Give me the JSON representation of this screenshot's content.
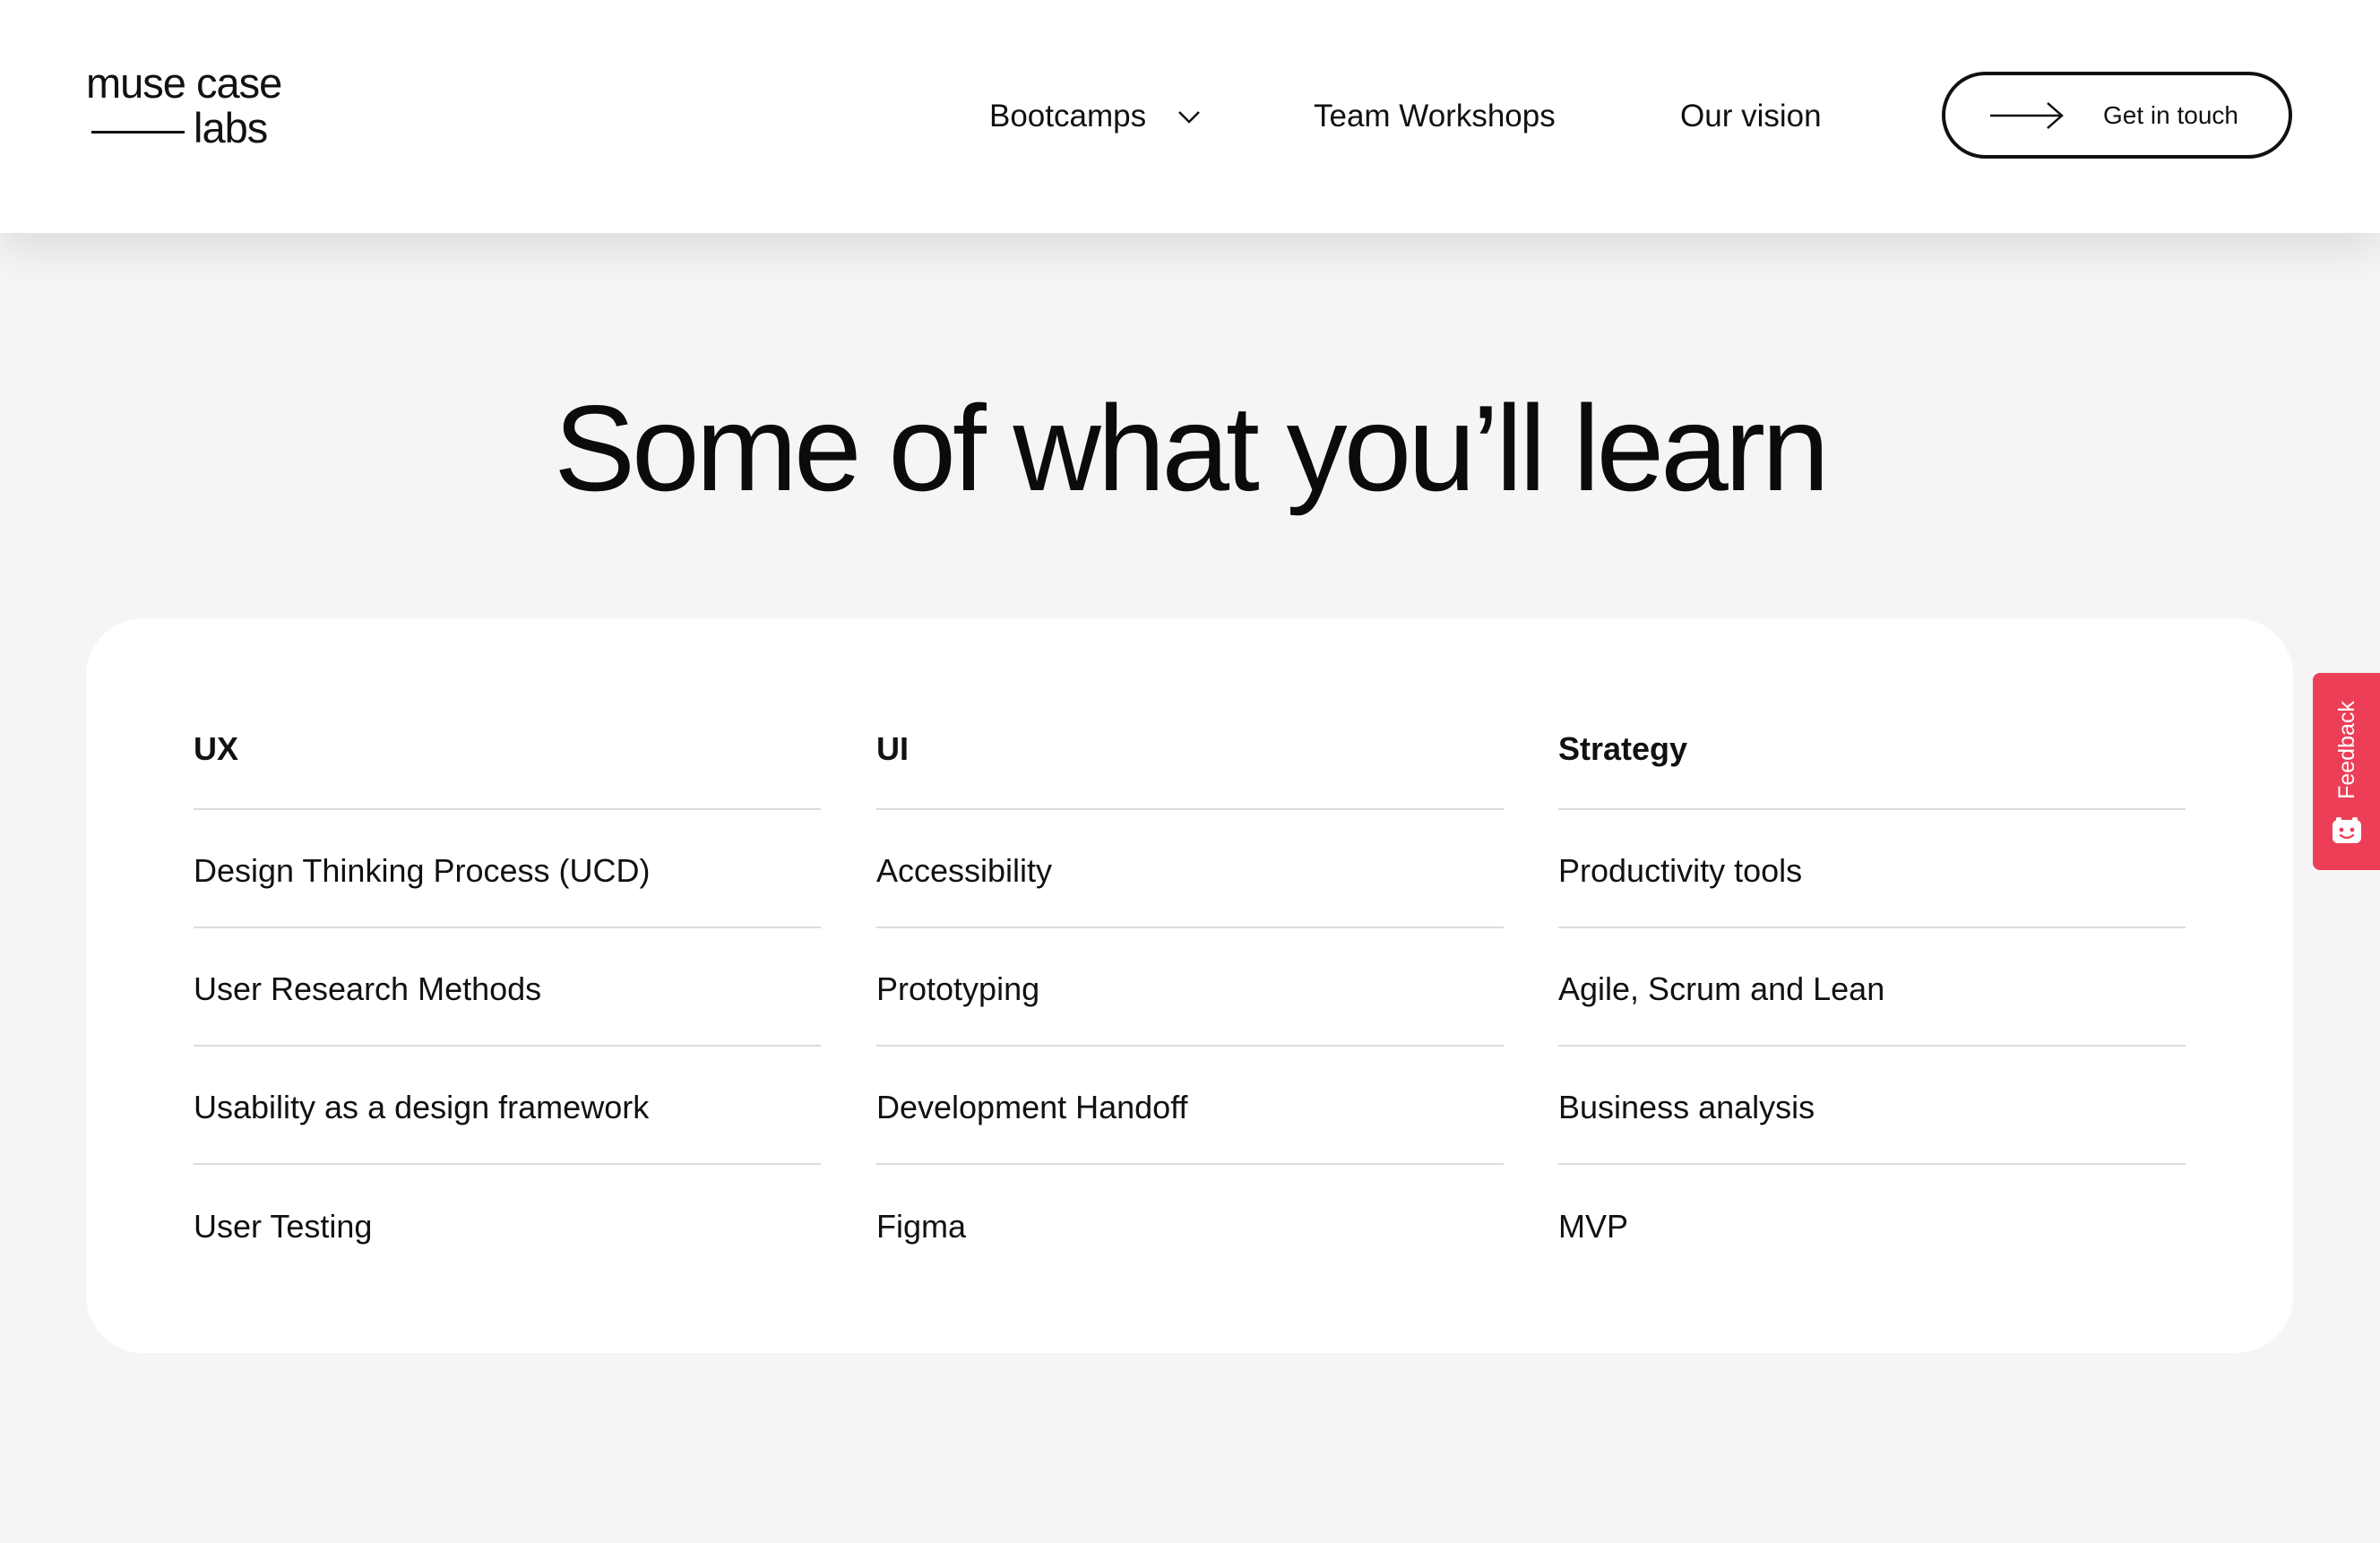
{
  "header": {
    "logo": {
      "line1": "muse case",
      "line2": "labs"
    },
    "nav": {
      "bootcamps": "Bootcamps",
      "workshops": "Team Workshops",
      "vision": "Our vision"
    },
    "cta": {
      "label": "Get in touch"
    }
  },
  "main": {
    "title": "Some of what you’ll learn",
    "columns": [
      {
        "heading": "UX",
        "items": [
          "Design Thinking Process (UCD)",
          "User Research Methods",
          "Usability as a design framework",
          "User Testing"
        ]
      },
      {
        "heading": "UI",
        "items": [
          "Accessibility",
          "Prototyping",
          "Development Handoff",
          "Figma"
        ]
      },
      {
        "heading": "Strategy",
        "items": [
          "Productivity tools",
          "Agile, Scrum and Lean",
          "Business analysis",
          "MVP"
        ]
      }
    ]
  },
  "feedback": {
    "label": "Feedback"
  },
  "colors": {
    "page_background": "#f5f5f7",
    "card_background": "#ffffff",
    "text": "#111111",
    "feedback_accent": "#ec3f57"
  },
  "icons": {
    "nav_dropdown": "chevron-down-icon",
    "cta": "arrow-right-icon",
    "feedback": "smiley-icon"
  }
}
